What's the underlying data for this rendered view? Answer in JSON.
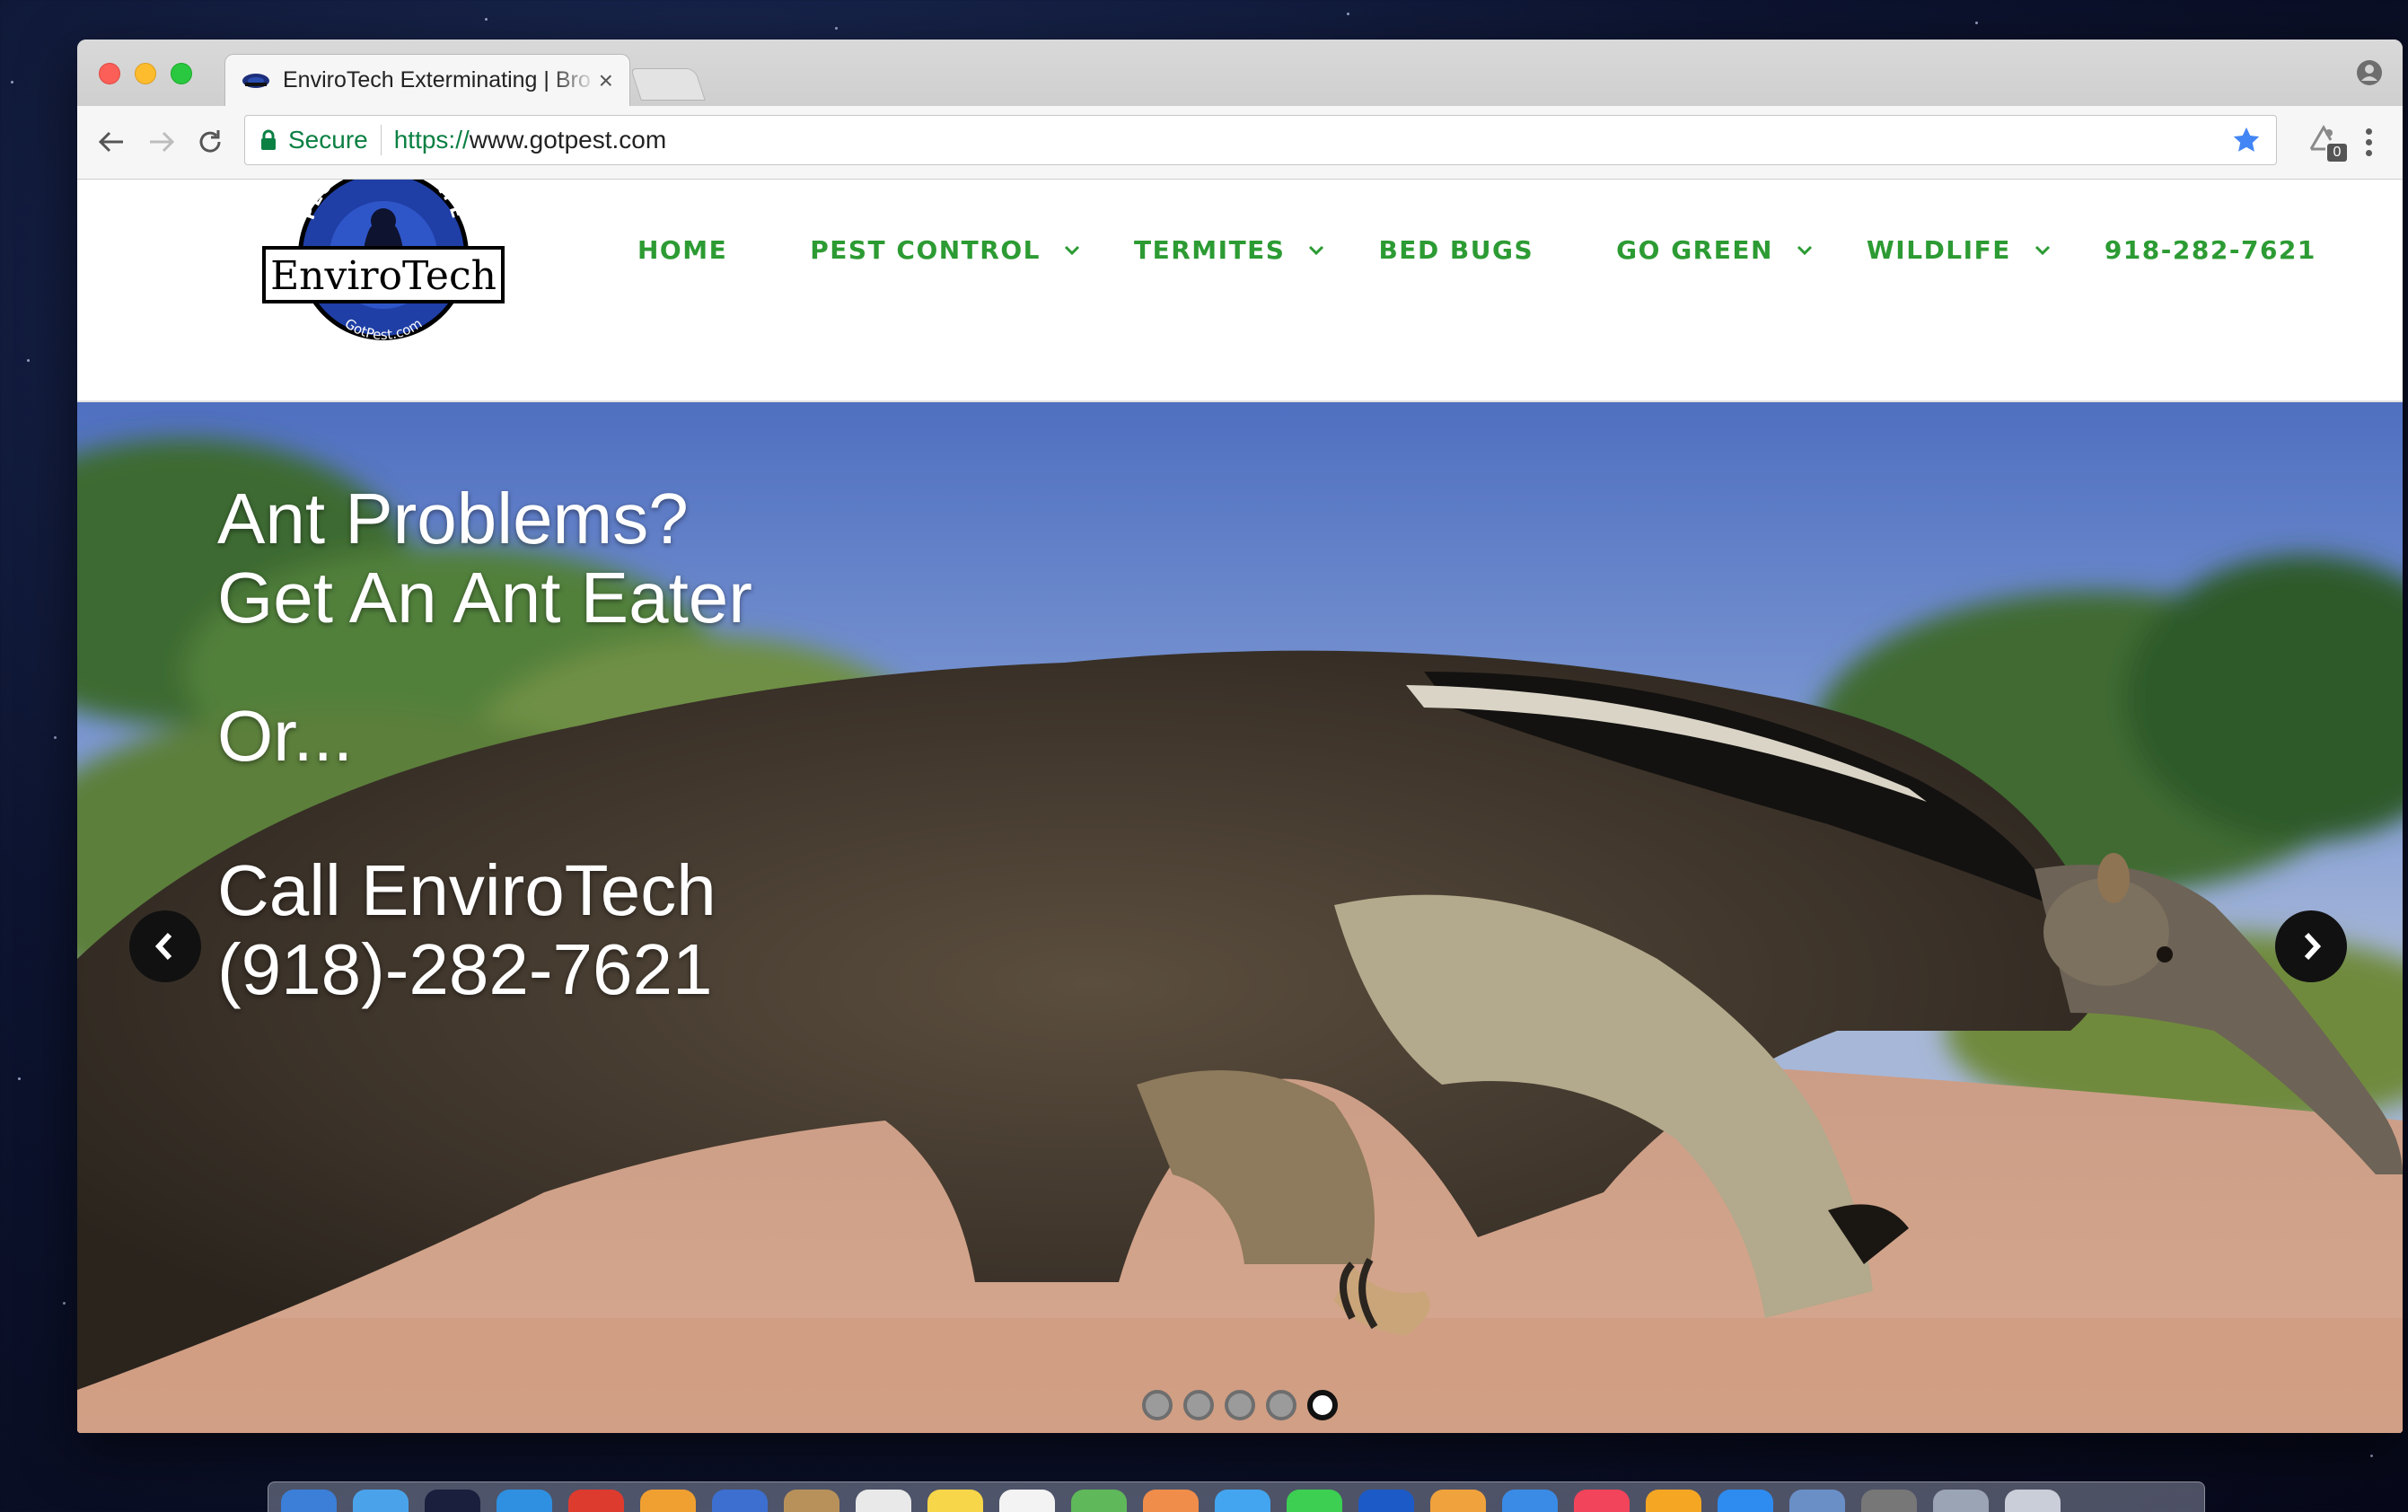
{
  "browser": {
    "tab": {
      "title": "EnviroTech Exterminating | Bro",
      "close_glyph": "×"
    },
    "address_bar": {
      "secure_label": "Secure",
      "url_scheme": "https://",
      "url_host": "www.gotpest.com"
    },
    "extension_badge": "0"
  },
  "site": {
    "logo": {
      "brand": "EnviroTech",
      "ring_top": "PEST & WILDLIFE",
      "ring_bottom": "GotPest.com"
    },
    "nav": [
      {
        "label": "HOME",
        "has_dropdown": false
      },
      {
        "label": "PEST CONTROL",
        "has_dropdown": true
      },
      {
        "label": "TERMITES",
        "has_dropdown": true
      },
      {
        "label": "BED BUGS",
        "has_dropdown": false
      },
      {
        "label": "GO GREEN",
        "has_dropdown": true
      },
      {
        "label": "WILDLIFE",
        "has_dropdown": true
      },
      {
        "label": "918-282-7621",
        "has_dropdown": false
      }
    ],
    "hero": {
      "line1": "Ant Problems?",
      "line2": "Get An Ant Eater",
      "line3": "Or...",
      "line4": "Call EnviroTech",
      "line5": "(918)-282-7621",
      "slide_count": 5,
      "active_slide": 5
    }
  },
  "colors": {
    "nav_green": "#2c9b33",
    "secure_green": "#0b8043",
    "bookmark_blue": "#4285f4"
  }
}
